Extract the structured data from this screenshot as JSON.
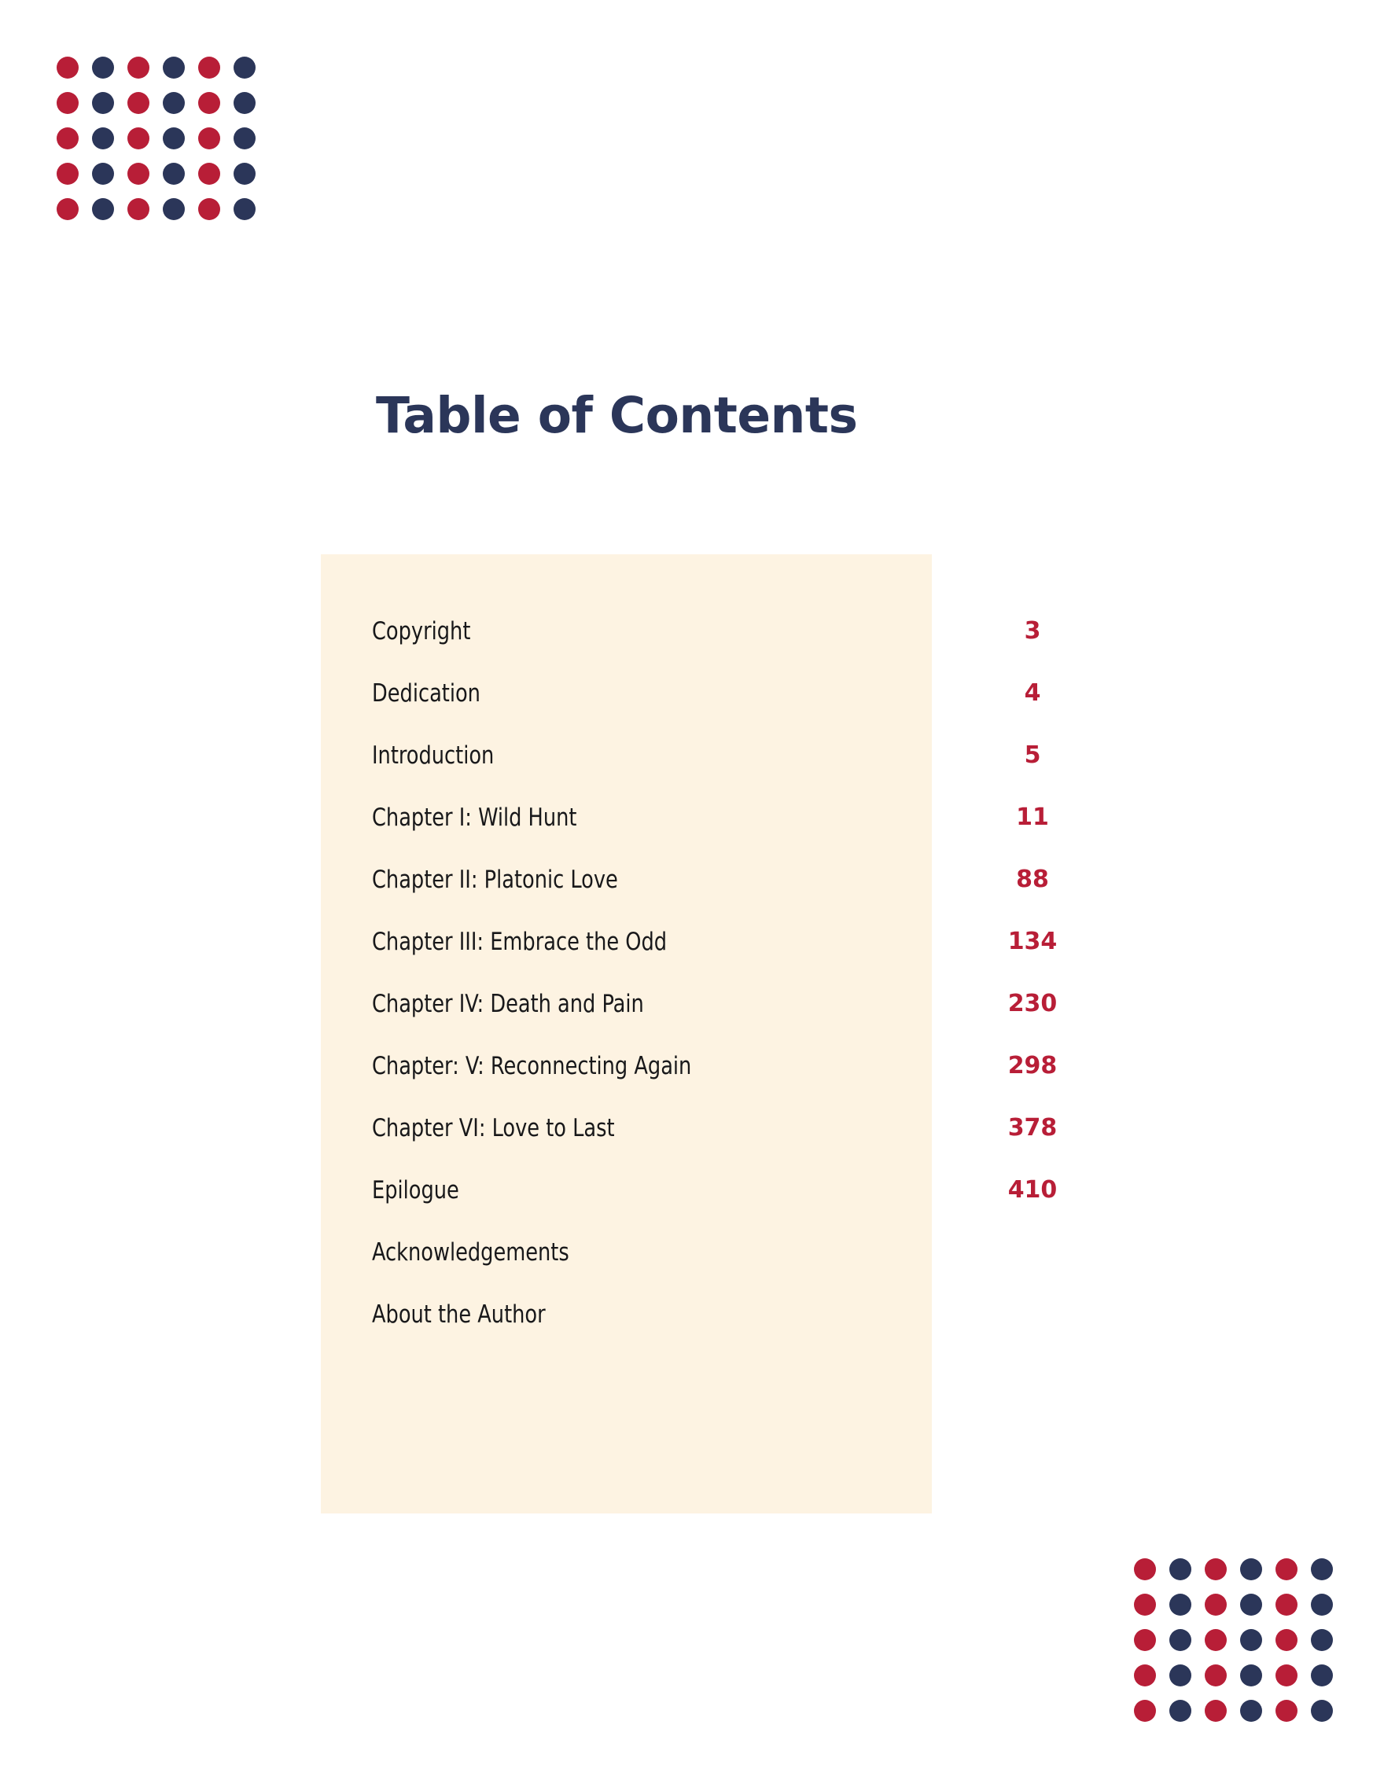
{
  "document": {
    "title": "Table of Contents",
    "page_background": "#ffffff"
  },
  "colors": {
    "navy": "#2b3659",
    "red": "#b81e37",
    "panel_cream": "#fdf3e2",
    "entry_text": "#18181a"
  },
  "decoration": {
    "dot_grid": {
      "columns": 6,
      "rows": 5,
      "column_colors": [
        "#b81e37",
        "#2b3659",
        "#b81e37",
        "#2b3659",
        "#b81e37",
        "#2b3659"
      ]
    }
  },
  "contents": {
    "entries": [
      {
        "label": "Copyright",
        "page": "3"
      },
      {
        "label": "Dedication",
        "page": "4"
      },
      {
        "label": "Introduction",
        "page": "5"
      },
      {
        "label": "Chapter I: Wild Hunt",
        "page": "11"
      },
      {
        "label": "Chapter II: Platonic Love",
        "page": "88"
      },
      {
        "label": "Chapter III: Embrace the Odd",
        "page": "134"
      },
      {
        "label": "Chapter IV: Death and Pain",
        "page": "230"
      },
      {
        "label": "Chapter: V: Reconnecting Again",
        "page": "298"
      },
      {
        "label": "Chapter VI: Love to Last",
        "page": "378"
      },
      {
        "label": "Epilogue",
        "page": "410"
      },
      {
        "label": "Acknowledgements",
        "page": ""
      },
      {
        "label": "About the Author",
        "page": ""
      }
    ]
  }
}
